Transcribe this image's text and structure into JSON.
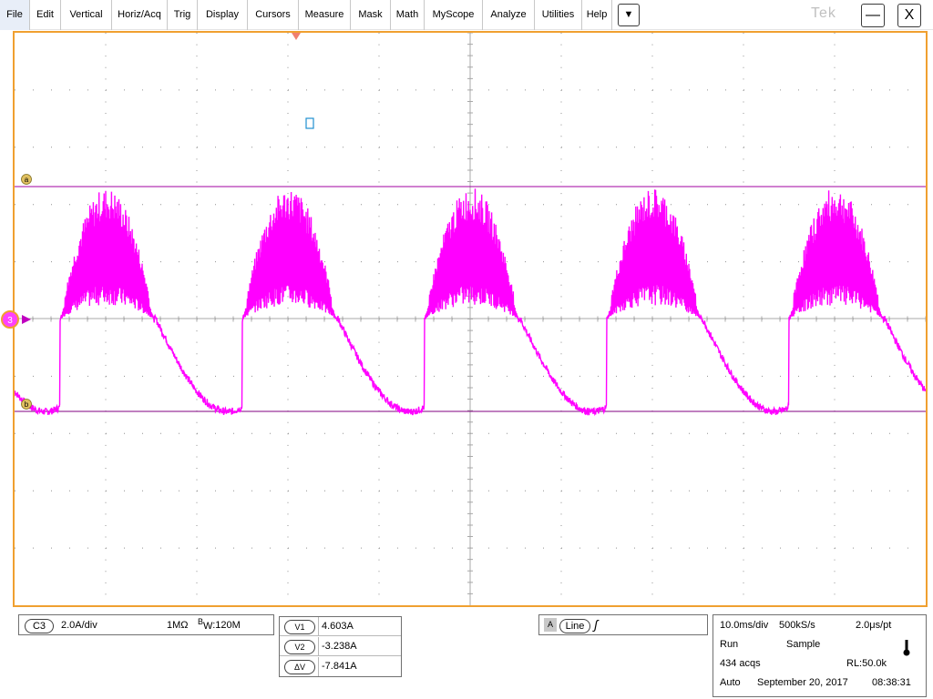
{
  "menu": {
    "items": [
      {
        "label": "File",
        "name": "menu-file"
      },
      {
        "label": "Edit",
        "name": "menu-edit"
      },
      {
        "label": "Vertical",
        "name": "menu-vertical"
      },
      {
        "label": "Horiz/Acq",
        "name": "menu-horiz-acq"
      },
      {
        "label": "Trig",
        "name": "menu-trig"
      },
      {
        "label": "Display",
        "name": "menu-display"
      },
      {
        "label": "Cursors",
        "name": "menu-cursors"
      },
      {
        "label": "Measure",
        "name": "menu-measure"
      },
      {
        "label": "Mask",
        "name": "menu-mask"
      },
      {
        "label": "Math",
        "name": "menu-math"
      },
      {
        "label": "MyScope",
        "name": "menu-myscope"
      },
      {
        "label": "Analyze",
        "name": "menu-analyze"
      },
      {
        "label": "Utilities",
        "name": "menu-utilities"
      },
      {
        "label": "Help",
        "name": "menu-help"
      }
    ],
    "dropdown_glyph": "▼",
    "brand": "Tek",
    "minimize_glyph": "—",
    "close_glyph": "X"
  },
  "display": {
    "waveform_color": "#ff00ff",
    "frame_color": "#f0a030",
    "channel_marker": "3",
    "cursor_a_label": "a",
    "cursor_b_label": "b",
    "cursor_a_level_A": 4.603,
    "cursor_b_level_A": -3.238,
    "waveform_period_ms": 20
  },
  "channel": {
    "badge": "C3",
    "scale": "2.0A/div",
    "coupling": "1MΩ",
    "bw_prefix": "B",
    "bw_sub": "W",
    "bw_value": ":120M"
  },
  "cursors": {
    "rows": [
      {
        "label": "V1",
        "value": "4.603A"
      },
      {
        "label": "V2",
        "value": "-3.238A"
      },
      {
        "label": "ΔV",
        "value": "-7.841A"
      }
    ]
  },
  "trigger": {
    "source": "A",
    "type": "Line",
    "slope_glyph": "ʃ"
  },
  "acquisition": {
    "timebase": "10.0ms/div",
    "sample_rate": "500kS/s",
    "resolution": "2.0μs/pt",
    "state": "Run",
    "mode": "Sample",
    "acqs": "434 acqs",
    "record_length": "RL:50.0k",
    "trigger_mode": "Auto",
    "date": "September 20, 2017",
    "time": "08:38:31"
  }
}
